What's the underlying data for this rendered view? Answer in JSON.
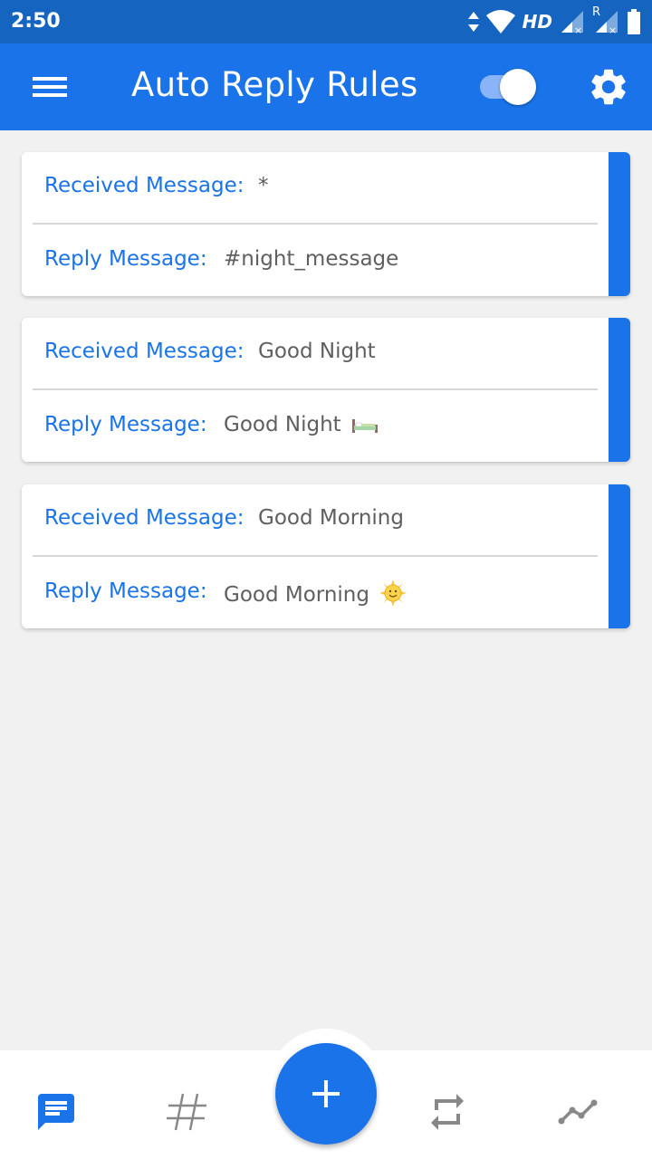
{
  "status_bar": {
    "time": "2:50",
    "network_label": "HD",
    "roaming_label": "R"
  },
  "app_bar": {
    "title": "Auto Reply Rules",
    "toggle_on": true,
    "icons": [
      "menu-icon",
      "gear-icon"
    ]
  },
  "rules": [
    {
      "received_label": "Received Message:",
      "received_value": "*",
      "reply_label": "Reply Message:",
      "reply_value": "#night_message"
    },
    {
      "received_label": "Received Message:",
      "received_value": "Good Night",
      "reply_label": "Reply Message:",
      "reply_value": "Good Night",
      "reply_emoji": "bed-emoji"
    },
    {
      "received_label": "Received Message:",
      "received_value": "Good Morning",
      "reply_label": "Reply Message:",
      "reply_value": "Good Morning",
      "reply_emoji": "sun-face-emoji"
    }
  ],
  "bottom_nav": {
    "items": [
      "messages-icon",
      "hashtag-icon",
      "repeat-icon",
      "stats-icon"
    ],
    "fab_icon": "plus-icon",
    "active_color": "#1a73e8",
    "inactive_color": "#888888"
  },
  "colors": {
    "primary": "#1a73e8",
    "status_bar": "#1565c0",
    "background": "#f1f1f1"
  }
}
